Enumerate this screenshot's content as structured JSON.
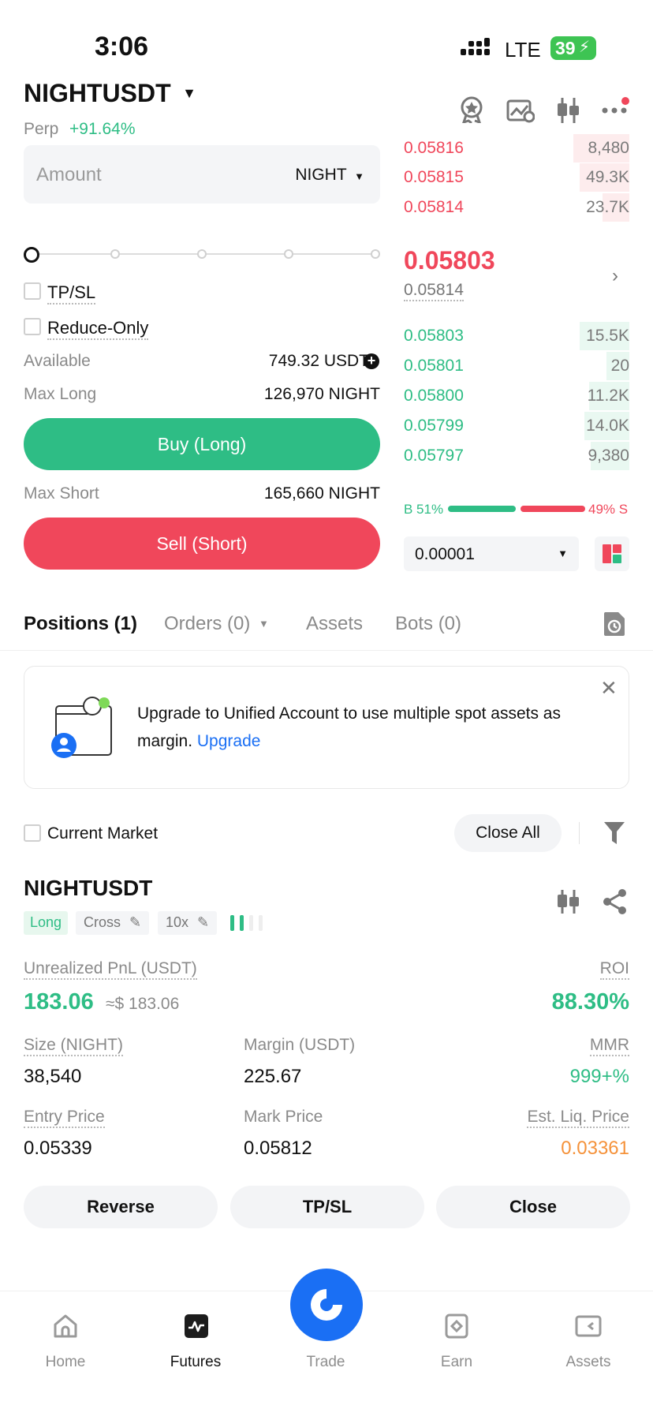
{
  "status_bar": {
    "time": "3:06",
    "network": "LTE",
    "battery": "39"
  },
  "header": {
    "pair": "NIGHTUSDT",
    "type": "Perp",
    "change": "+91.64%"
  },
  "order_form": {
    "amount_placeholder": "Amount",
    "unit": "NIGHT",
    "slider_percent": 0,
    "tp_sl_label": "TP/SL",
    "reduce_only_label": "Reduce-Only",
    "available_label": "Available",
    "available_value": "749.32 USDT",
    "max_long_label": "Max Long",
    "max_long_value": "126,970 NIGHT",
    "buy_label": "Buy (Long)",
    "max_short_label": "Max Short",
    "max_short_value": "165,660 NIGHT",
    "sell_label": "Sell (Short)"
  },
  "orderbook": {
    "asks": [
      {
        "price": "0.05816",
        "qty": "8,480",
        "depth": 0.25
      },
      {
        "price": "0.05815",
        "qty": "49.3K",
        "depth": 0.22
      },
      {
        "price": "0.05814",
        "qty": "23.7K",
        "depth": 0.12
      }
    ],
    "last_price": "0.05803",
    "mark_price": "0.05814",
    "bids": [
      {
        "price": "0.05803",
        "qty": "15.5K",
        "depth": 0.22
      },
      {
        "price": "0.05801",
        "qty": "20",
        "depth": 0.1
      },
      {
        "price": "0.05800",
        "qty": "11.2K",
        "depth": 0.18
      },
      {
        "price": "0.05799",
        "qty": "14.0K",
        "depth": 0.2
      },
      {
        "price": "0.05797",
        "qty": "9,380",
        "depth": 0.17
      }
    ],
    "buy_ratio": "B 51%",
    "sell_ratio": "49% S",
    "buy_fraction": 0.51,
    "precision": "0.00001"
  },
  "tabs": {
    "positions": "Positions (1)",
    "orders": "Orders (0)",
    "assets": "Assets",
    "bots": "Bots (0)"
  },
  "banner": {
    "text": "Upgrade to Unified Account to use multiple spot assets as margin.",
    "link": "Upgrade"
  },
  "filter": {
    "current_market": "Current Market",
    "close_all": "Close All"
  },
  "position": {
    "symbol": "NIGHTUSDT",
    "side": "Long",
    "margin_mode": "Cross",
    "leverage": "10x",
    "pnl_label": "Unrealized PnL (USDT)",
    "pnl_value": "183.06",
    "pnl_usd": "≈$ 183.06",
    "roi_label": "ROI",
    "roi_value": "88.30%",
    "size_label": "Size (NIGHT)",
    "size_value": "38,540",
    "margin_label": "Margin (USDT)",
    "margin_value": "225.67",
    "mmr_label": "MMR",
    "mmr_value": "999+%",
    "entry_label": "Entry Price",
    "entry_value": "0.05339",
    "mark_label": "Mark Price",
    "mark_value": "0.05812",
    "liq_label": "Est. Liq. Price",
    "liq_value": "0.03361",
    "reverse": "Reverse",
    "tpsl": "TP/SL",
    "close": "Close"
  },
  "bottom_nav": {
    "home": "Home",
    "futures": "Futures",
    "trade": "Trade",
    "earn": "Earn",
    "assets": "Assets"
  },
  "colors": {
    "green": "#2ebd85",
    "red": "#f0475b",
    "blue": "#1a6ff4",
    "orange": "#f5923a"
  }
}
